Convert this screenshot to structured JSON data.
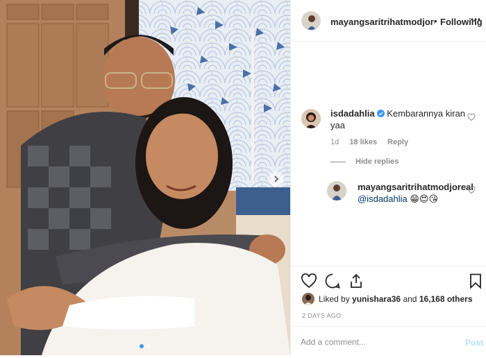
{
  "header": {
    "username": "mayangsaritrihatmodjoreal",
    "separator": "•",
    "follow_status": "Following",
    "more_icon": "ellipsis-icon"
  },
  "comments": [
    {
      "username": "isdadahlia",
      "verified": true,
      "text": "Kembarannya kiran yaa",
      "age": "1d",
      "likes": "18 likes",
      "reply_label": "Reply",
      "hide_replies_label": "Hide replies",
      "replies": [
        {
          "username": "mayangsaritrihatmodjoreal",
          "mention": "@isdadahlia",
          "emoji": "😁😍😘"
        }
      ]
    }
  ],
  "actions": {
    "like_icon": "heart-icon",
    "comment_icon": "comment-icon",
    "share_icon": "share-icon",
    "save_icon": "bookmark-icon"
  },
  "likes": {
    "prefix": "Liked by",
    "user": "yunishara36",
    "conjunction": "and",
    "others": "16,168 others"
  },
  "timestamp": "2 DAYS AGO",
  "add_comment": {
    "placeholder": "Add a comment...",
    "post_label": "Post"
  },
  "carousel": {
    "slide_count": 2,
    "current_slide": 1
  },
  "colors": {
    "verified_badge": "#3897f0",
    "post_button_disabled": "#b2dffc",
    "mention": "#00376b"
  }
}
